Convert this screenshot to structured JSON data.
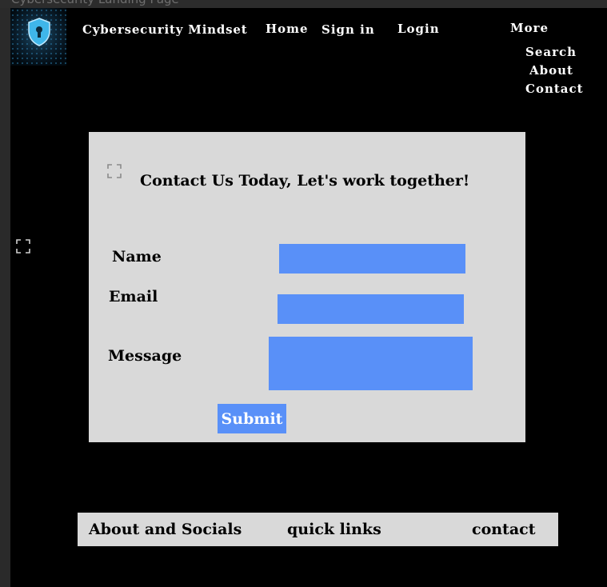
{
  "window": {
    "title": "Cybersecurity Landing Page"
  },
  "header": {
    "logo_icon": "shield-lock-icon",
    "site_title": "Cybersecurity Mindset",
    "nav": {
      "home": "Home",
      "sign_in": "Sign in",
      "login": "Login",
      "more": "More"
    },
    "more_menu": {
      "search": "Search",
      "about": "About",
      "contact": "Contact"
    }
  },
  "contact_form": {
    "heading": "Contact Us Today, Let's work together!",
    "name_label": "Name",
    "email_label": "Email",
    "message_label": "Message",
    "name_value": "",
    "email_value": "",
    "message_value": "",
    "submit_label": "Submit"
  },
  "footer": {
    "about_socials": "About and Socials",
    "quick_links": "quick links",
    "contact": "contact"
  },
  "colors": {
    "page_background": "#000000",
    "card_background": "#d9d9d9",
    "input_fill": "#5990f8",
    "nav_text": "#ffffff"
  }
}
